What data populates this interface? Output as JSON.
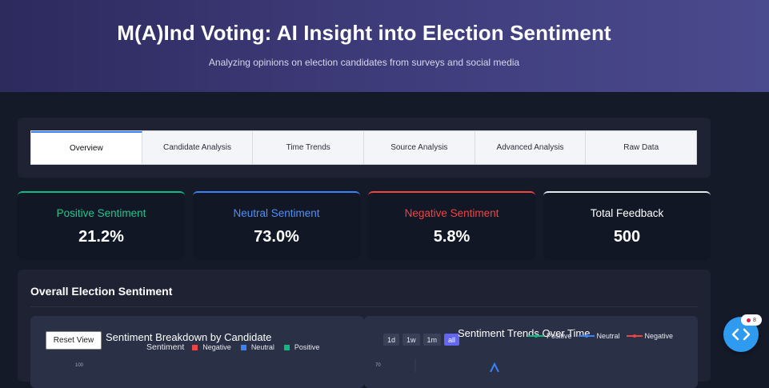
{
  "header": {
    "title": "M(A)Ind Voting: AI Insight into Election Sentiment",
    "subtitle": "Analyzing opinions on election candidates from surveys and social media"
  },
  "tabs": [
    {
      "label": "Overview",
      "active": true
    },
    {
      "label": "Candidate Analysis",
      "active": false
    },
    {
      "label": "Time Trends",
      "active": false
    },
    {
      "label": "Source Analysis",
      "active": false
    },
    {
      "label": "Advanced Analysis",
      "active": false
    },
    {
      "label": "Raw Data",
      "active": false
    }
  ],
  "cards": {
    "positive": {
      "label": "Positive Sentiment",
      "value": "21.2%",
      "color": "#10b981"
    },
    "neutral": {
      "label": "Neutral Sentiment",
      "value": "73.0%",
      "color": "#3b82f6"
    },
    "negative": {
      "label": "Negative Sentiment",
      "value": "5.8%",
      "color": "#ef4444"
    },
    "total": {
      "label": "Total Feedback",
      "value": "500"
    }
  },
  "section": {
    "title": "Overall Election Sentiment"
  },
  "breakdown_chart": {
    "reset_label": "Reset View",
    "title": "Sentiment Breakdown by Candidate",
    "legend_title": "Sentiment",
    "legend": [
      {
        "name": "Negative",
        "color": "#ef4444"
      },
      {
        "name": "Neutral",
        "color": "#3b82f6"
      },
      {
        "name": "Positive",
        "color": "#10b981"
      }
    ],
    "tick_top": "100"
  },
  "trends_chart": {
    "title": "Sentiment Trends Over Time",
    "ranges": [
      {
        "label": "1d",
        "active": false
      },
      {
        "label": "1w",
        "active": false
      },
      {
        "label": "1m",
        "active": false
      },
      {
        "label": "all",
        "active": true
      }
    ],
    "legend": [
      {
        "name": "Positive",
        "color": "#10b981"
      },
      {
        "name": "Neutral",
        "color": "#3b82f6"
      },
      {
        "name": "Negative",
        "color": "#ef4444"
      }
    ],
    "tick_top": "70"
  },
  "fab": {
    "badge": "8",
    "color": "#2f9bf0"
  }
}
